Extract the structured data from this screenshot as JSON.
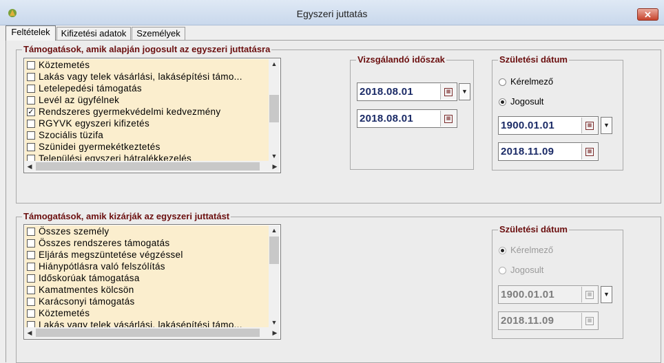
{
  "window": {
    "title": "Egyszeri juttatás",
    "close_glyph": "✕"
  },
  "tabs": [
    {
      "label": "Feltételek",
      "active": true
    },
    {
      "label": "Kifizetési adatok",
      "active": false
    },
    {
      "label": "Személyek",
      "active": false
    }
  ],
  "group_eligible": {
    "legend": "Támogatások, amik alapján jogosult az egyszeri juttatásra",
    "items": [
      {
        "label": "Köztemetés",
        "checked": false
      },
      {
        "label": "Lakás vagy telek vásárlási, lakásépítési támo...",
        "checked": false
      },
      {
        "label": "Letelepedési támogatás",
        "checked": false
      },
      {
        "label": "Levél az ügyfélnek",
        "checked": false
      },
      {
        "label": "Rendszeres gyermekvédelmi kedvezmény",
        "checked": true
      },
      {
        "label": "RGYVK egyszeri kifizetés",
        "checked": false
      },
      {
        "label": "Szociális tüzifa",
        "checked": false
      },
      {
        "label": "Szünidei gyermekétkeztetés",
        "checked": false
      },
      {
        "label": "Települési egyszeri hátralékkezelés",
        "checked": false
      }
    ]
  },
  "period": {
    "legend": "Vizsgálandó időszak",
    "from": "2018.08.01",
    "to": "2018.08.01"
  },
  "birth_top": {
    "legend": "Születési dátum",
    "radio_applicant": "Kérelmező",
    "radio_entitled": "Jogosult",
    "selected": "Jogosult",
    "from": "1900.01.01",
    "to": "2018.11.09"
  },
  "group_excluding": {
    "legend": "Támogatások, amik kizárják az egyszeri juttatást",
    "items": [
      {
        "label": "Összes személy",
        "checked": false
      },
      {
        "label": "Összes rendszeres támogatás",
        "checked": false
      },
      {
        "label": "Eljárás megszüntetése végzéssel",
        "checked": false
      },
      {
        "label": "Hiánypótlásra való felszólítás",
        "checked": false
      },
      {
        "label": "Időskorúak támogatása",
        "checked": false
      },
      {
        "label": "Kamatmentes kölcsön",
        "checked": false
      },
      {
        "label": "Karácsonyi támogatás",
        "checked": false
      },
      {
        "label": "Köztemetés",
        "checked": false
      },
      {
        "label": "Lakás vagy telek vásárlási, lakásépítési támo...",
        "checked": false
      }
    ]
  },
  "birth_bottom": {
    "legend": "Születési dátum",
    "radio_applicant": "Kérelmező",
    "radio_entitled": "Jogosult",
    "selected": "Kérelmező",
    "from": "1900.01.01",
    "to": "2018.11.09",
    "disabled": true
  },
  "icons": {
    "calendar": "calendar-icon",
    "dropdown": "chevron-down-icon",
    "scroll_up": "▲",
    "scroll_down": "▼",
    "scroll_left": "◀",
    "scroll_right": "▶"
  },
  "colors": {
    "list_background": "#fbeece",
    "legend_text": "#6b0f0f",
    "date_text": "#1a2a66"
  }
}
